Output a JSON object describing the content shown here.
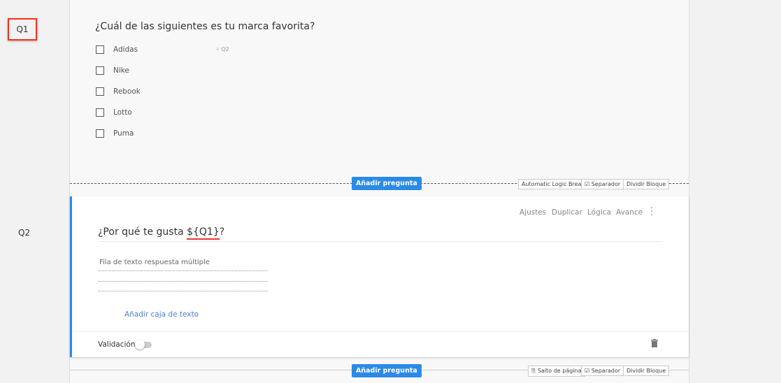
{
  "q1": {
    "label": "Q1",
    "title": "¿Cuál de las siguientes es tu marca favorita?",
    "options": [
      "Adidas",
      "Nike",
      "Rebook",
      "Lotto",
      "Puma"
    ],
    "logic_target": "Q2"
  },
  "sep1": {
    "add": "Añadir pregunta",
    "break": "Automatic Logic Break",
    "separator": "Separador",
    "split": "Dividir Bloque"
  },
  "q2": {
    "label": "Q2",
    "title_prefix": "¿Por qué te gusta ",
    "title_pipe": "${Q1}",
    "title_suffix": "?",
    "actions": [
      "Ajustes",
      "Duplicar",
      "Lógica",
      "Avance"
    ],
    "placeholder": "Fila de texto respuesta múltiple",
    "add_box": "Añadir caja de texto",
    "validation": "Validación",
    "validation_on": false
  },
  "sep2": {
    "add": "Añadir pregunta",
    "break": "Salto de página",
    "separator": "Separador",
    "split": "Dividir Bloque"
  }
}
